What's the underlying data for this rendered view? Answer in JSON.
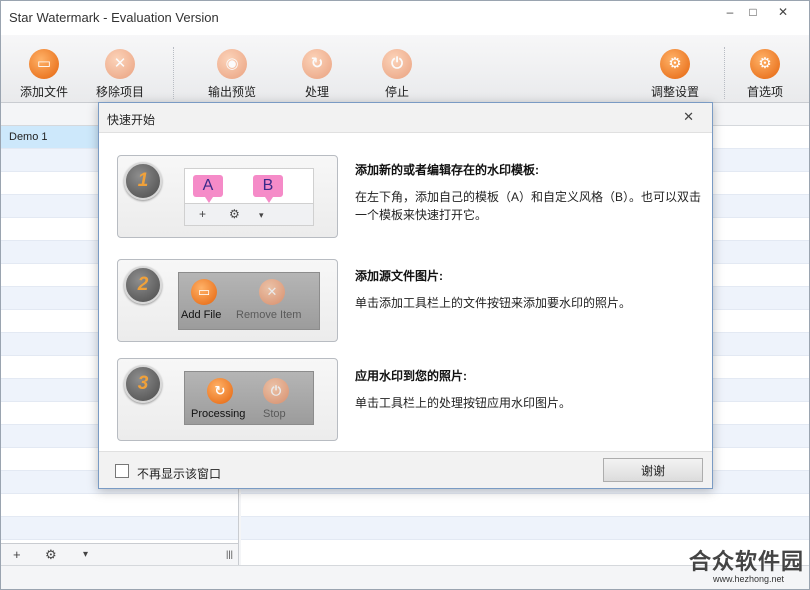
{
  "window": {
    "title": "Star Watermark - Evaluation Version",
    "min": "‒",
    "max": "□",
    "close": "✕"
  },
  "toolbar": {
    "add_file": "添加文件",
    "remove_item": "移除项目",
    "export_preview": "输出预览",
    "process": "处理",
    "stop": "停止",
    "adjust_settings": "调整设置",
    "preferences": "首选项"
  },
  "template_list": {
    "items": [
      "Demo 1"
    ]
  },
  "bottom_bar": {
    "add": "+",
    "gear": "⚙",
    "dropdown": "▾",
    "grip": "|||"
  },
  "dialog": {
    "title": "快速开始",
    "close": "✕",
    "steps": [
      {
        "number": "1",
        "heading": "添加新的或者编辑存在的水印模板:",
        "text": "在左下角，添加自己的模板（A）和自定义风格（B）。也可以双击一个模板来快速打开它。",
        "pin_a": "A",
        "pin_b": "B"
      },
      {
        "number": "2",
        "heading": "添加源文件图片:",
        "text": "单击添加工具栏上的文件按钮来添加要水印的照片。",
        "btn1": "Add File",
        "btn2": "Remove Item"
      },
      {
        "number": "3",
        "heading": "应用水印到您的照片:",
        "text": "单击工具栏上的处理按钮应用水印图片。",
        "btn1": "Processing",
        "btn2": "Stop"
      }
    ],
    "dont_show": "不再显示该窗口",
    "ok": "谢谢"
  },
  "watermark": {
    "site_name": "合众软件园",
    "url": "www.hezhong.net"
  }
}
